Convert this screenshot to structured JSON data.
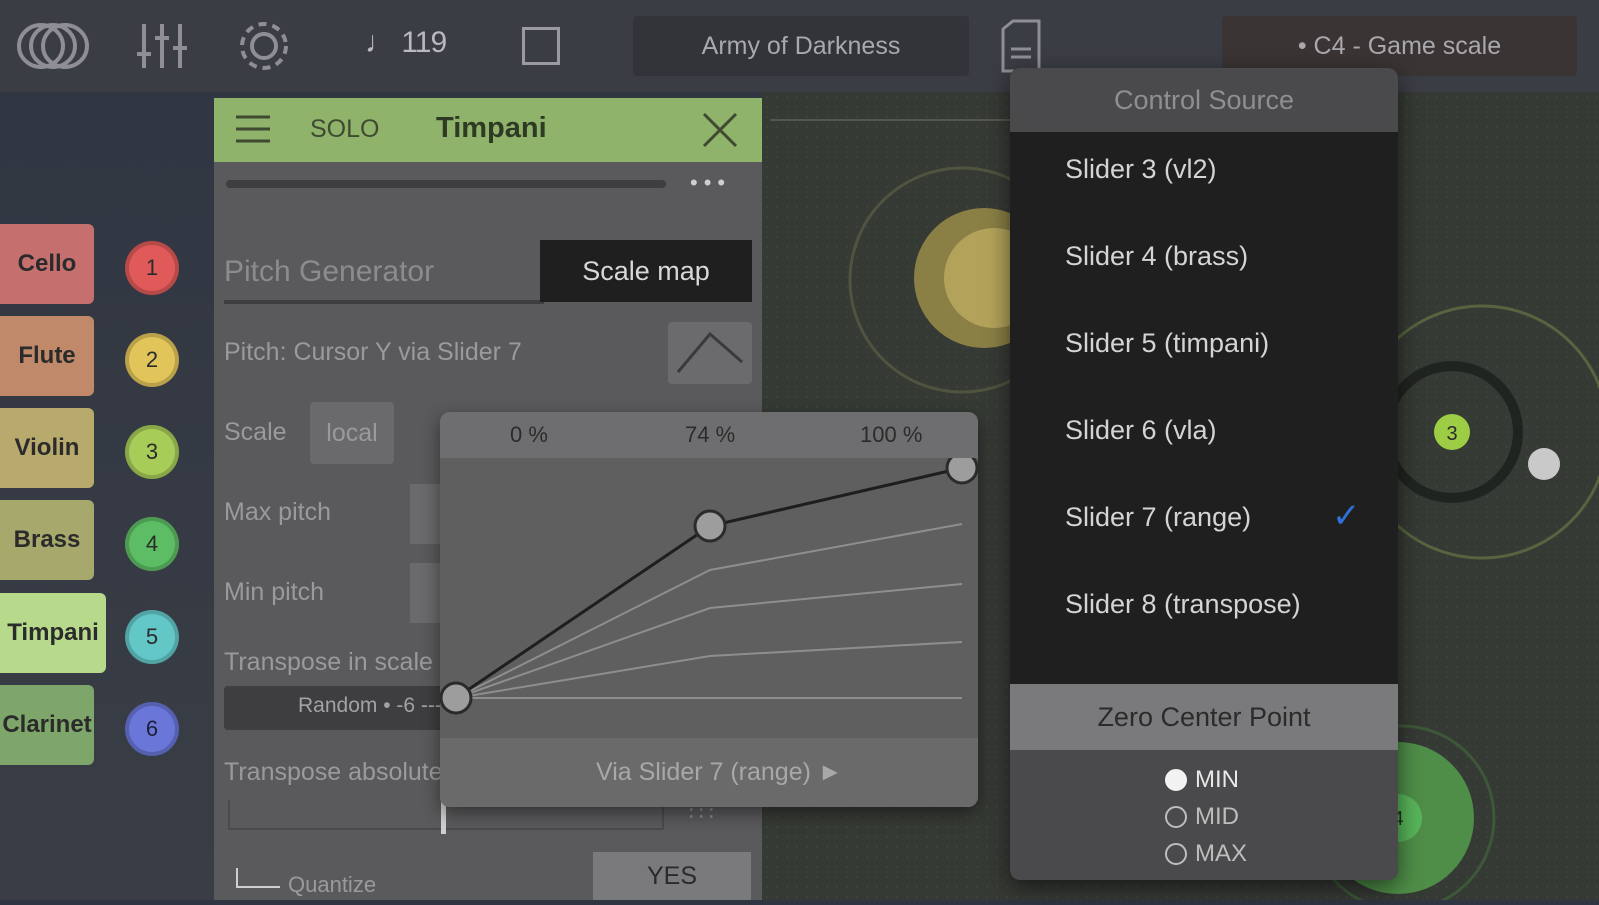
{
  "topbar": {
    "tempo": "♩ 119",
    "song_title": "Army of Darkness",
    "scale_label": "• C4 - Game scale"
  },
  "instruments": [
    {
      "label": "Cello",
      "number": "1",
      "tab_color": "#c66f6f",
      "dot_color": "#e05a5a"
    },
    {
      "label": "Flute",
      "number": "2",
      "tab_color": "#c08a6a",
      "dot_color": "#e2c55a"
    },
    {
      "label": "Violin",
      "number": "3",
      "tab_color": "#b8a96c",
      "dot_color": "#a8cc58"
    },
    {
      "label": "Brass",
      "number": "4",
      "tab_color": "#a7a96c",
      "dot_color": "#5dbd64"
    },
    {
      "label": "Timpani",
      "number": "5",
      "tab_color": "#b6d98c",
      "dot_color": "#63c7c8"
    },
    {
      "label": "Clarinet",
      "number": "6",
      "tab_color": "#7fa66a",
      "dot_color": "#6a76d8"
    }
  ],
  "panel": {
    "solo_label": "SOLO",
    "title": "Timpani",
    "section_title": "Pitch Generator",
    "scale_map_button": "Scale map",
    "pitch_source": "Pitch: Cursor Y via Slider 7",
    "scale_label": "Scale",
    "scale_value": "local",
    "max_pitch_label": "Max pitch",
    "min_pitch_label": "Min pitch",
    "transpose_scale_label": "Transpose in scale",
    "random_label": "Random • -6 ---",
    "transpose_abs_label": "Transpose absolute",
    "quantize_label": "Quantize",
    "yes_button": "YES"
  },
  "curve_popup": {
    "columns": [
      "0 %",
      "74 %",
      "100 %"
    ],
    "footer": "Via Slider 7 (range) ►"
  },
  "canvas_nodes": [
    {
      "label": "3"
    },
    {
      "label": "4"
    }
  ],
  "control_source": {
    "header": "Control Source",
    "items": [
      {
        "label": "Slider 3 (vl2)",
        "selected": false
      },
      {
        "label": "Slider 4 (brass)",
        "selected": false
      },
      {
        "label": "Slider 5 (timpani)",
        "selected": false
      },
      {
        "label": "Slider 6 (vla)",
        "selected": false
      },
      {
        "label": "Slider 7 (range)",
        "selected": true
      },
      {
        "label": "Slider 8 (transpose)",
        "selected": false
      }
    ],
    "check_mark": "✓",
    "zero_center_header": "Zero Center Point",
    "zero_center_options": [
      {
        "label": "MIN",
        "selected": true
      },
      {
        "label": "MID",
        "selected": false
      },
      {
        "label": "MAX",
        "selected": false
      }
    ]
  },
  "colors": {
    "panel_header": "#8fb36a",
    "check": "#2f6fd6"
  }
}
